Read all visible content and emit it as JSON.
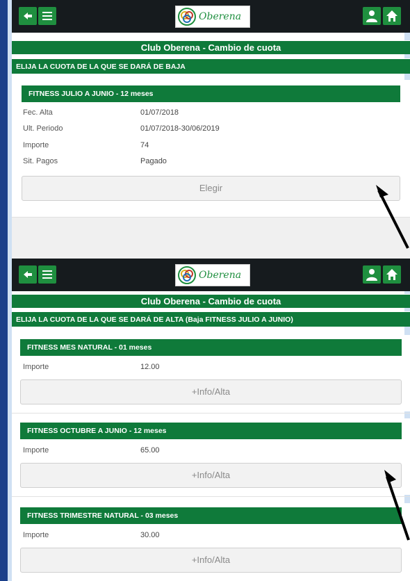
{
  "top": {
    "title": "Club Oberena - Cambio de cuota",
    "section": "ELIJA LA CUOTA DE LA QUE SE DARÁ DE BAJA",
    "card": {
      "head": "FITNESS JULIO A JUNIO - 12 meses",
      "rows": [
        {
          "label": "Fec. Alta",
          "value": "01/07/2018"
        },
        {
          "label": "Ult. Periodo",
          "value": "01/07/2018-30/06/2019"
        },
        {
          "label": "Importe",
          "value": "74"
        },
        {
          "label": "Sit. Pagos",
          "value": "Pagado"
        }
      ],
      "button": "Elegir"
    }
  },
  "bottom": {
    "title": "Club Oberena - Cambio de cuota",
    "section": "ELIJA LA CUOTA DE LA QUE SE DARÁ DE ALTA (Baja FITNESS JULIO A JUNIO)",
    "cards": [
      {
        "head": "FITNESS MES NATURAL - 01 meses",
        "label": "Importe",
        "value": "12.00",
        "button": "+Info/Alta"
      },
      {
        "head": "FITNESS OCTUBRE A JUNIO - 12 meses",
        "label": "Importe",
        "value": "65.00",
        "button": "+Info/Alta"
      },
      {
        "head": "FITNESS TRIMESTRE NATURAL - 03 meses",
        "label": "Importe",
        "value": "30.00",
        "button": "+Info/Alta"
      }
    ]
  },
  "logo_text": "Oberena",
  "icons": [
    "back-arrow-icon",
    "menu-icon",
    "user-icon",
    "home-icon",
    "pointer-arrow-icon"
  ],
  "colors": {
    "brand_green": "#0f7a3a",
    "nav_dark": "#161b1e",
    "button_bg": "#f2f2f2"
  }
}
